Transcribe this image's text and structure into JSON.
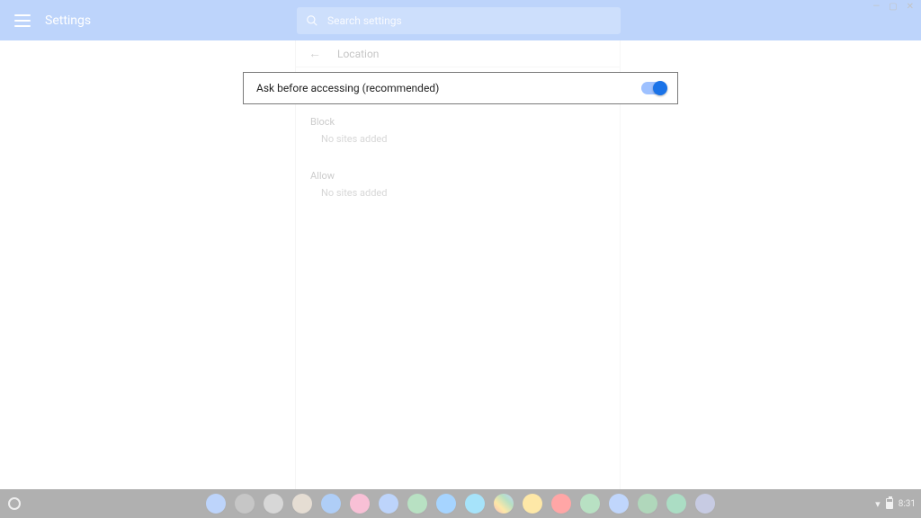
{
  "window_controls": {
    "minimize": "—",
    "maximize": "▢",
    "close": "✕"
  },
  "header": {
    "app_title": "Settings",
    "search_placeholder": "Search settings"
  },
  "breadcrumb": {
    "label": "Location"
  },
  "toggle_row": {
    "label": "Ask before accessing (recommended)",
    "on": true
  },
  "sections": {
    "block": {
      "title": "Block",
      "empty_text": "No sites added"
    },
    "allow": {
      "title": "Allow",
      "empty_text": "No sites added"
    }
  },
  "shelf": {
    "apps": [
      {
        "name": "files",
        "color": "#4285f4"
      },
      {
        "name": "store",
        "color": "#5c5c5c"
      },
      {
        "name": "settings-grey",
        "color": "#8e8e8e"
      },
      {
        "name": "chrome-canary",
        "color": "#b59f82"
      },
      {
        "name": "web-app",
        "color": "#1a73e8"
      },
      {
        "name": "music",
        "color": "#ea4c89"
      },
      {
        "name": "mail",
        "color": "#4285f4"
      },
      {
        "name": "chat",
        "color": "#34a853"
      },
      {
        "name": "messenger",
        "color": "#0084ff"
      },
      {
        "name": "skype",
        "color": "#00aff0"
      },
      {
        "name": "chrome",
        "color": "linear-gradient(45deg,#ea4335,#fbbc05,#34a853,#4285f4)"
      },
      {
        "name": "keep",
        "color": "#fbbc04"
      },
      {
        "name": "youtube",
        "color": "#ff0000"
      },
      {
        "name": "play",
        "color": "#34a853"
      },
      {
        "name": "apps-blue",
        "color": "#4c8bf5"
      },
      {
        "name": "apps-green",
        "color": "#1e8e3e"
      },
      {
        "name": "drive",
        "color": "#0f9d58"
      },
      {
        "name": "camera",
        "color": "#5f6caf"
      }
    ],
    "tray": {
      "time": "8:31"
    }
  }
}
